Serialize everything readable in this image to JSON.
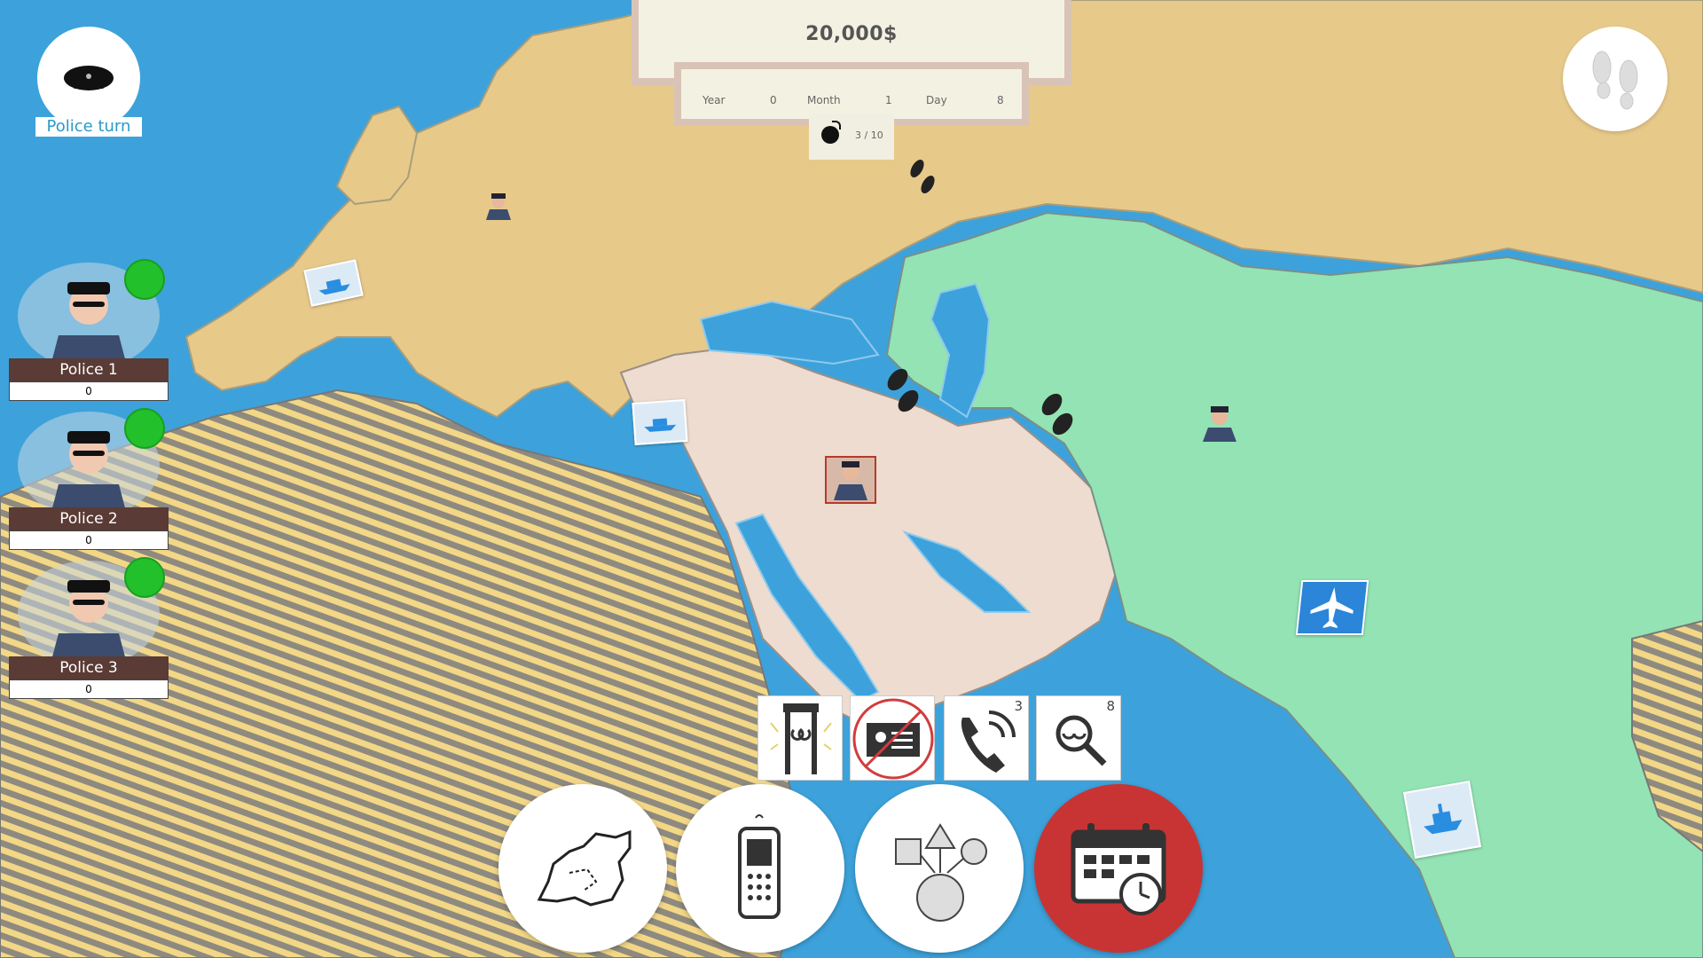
{
  "money": "20,000$",
  "date": {
    "year_label": "Year",
    "year_value": "0",
    "month_label": "Month",
    "month_value": "1",
    "day_label": "Day",
    "day_value": "8"
  },
  "bombs": {
    "text": "3  / 10"
  },
  "turn": {
    "label": "Police turn",
    "icon": "police-hat-icon"
  },
  "police": [
    {
      "name": "Police 1",
      "score": "0",
      "status_color": "#22c02a"
    },
    {
      "name": "Police 2",
      "score": "0",
      "status_color": "#22c02a"
    },
    {
      "name": "Police 3",
      "score": "0",
      "status_color": "#22c02a"
    }
  ],
  "actions": [
    {
      "icon": "metal-detector-icon",
      "count": ""
    },
    {
      "icon": "no-id-card-icon",
      "count": ""
    },
    {
      "icon": "phone-tap-icon",
      "count": "3"
    },
    {
      "icon": "search-mask-icon",
      "count": "8"
    }
  ],
  "buttons": [
    {
      "icon": "map-region-icon"
    },
    {
      "icon": "cell-phone-icon"
    },
    {
      "icon": "shapes-icon"
    },
    {
      "icon": "calendar-clock-icon",
      "active": true
    }
  ],
  "colors": {
    "ocean": "#3da2db",
    "europe_russia": "#e7c98a",
    "middle_east": "#eddccf",
    "central_south_asia": "#93e3b5",
    "africa_stripes": "#c9c29a",
    "active_button": "#c83434",
    "status_active": "#22c02a"
  }
}
